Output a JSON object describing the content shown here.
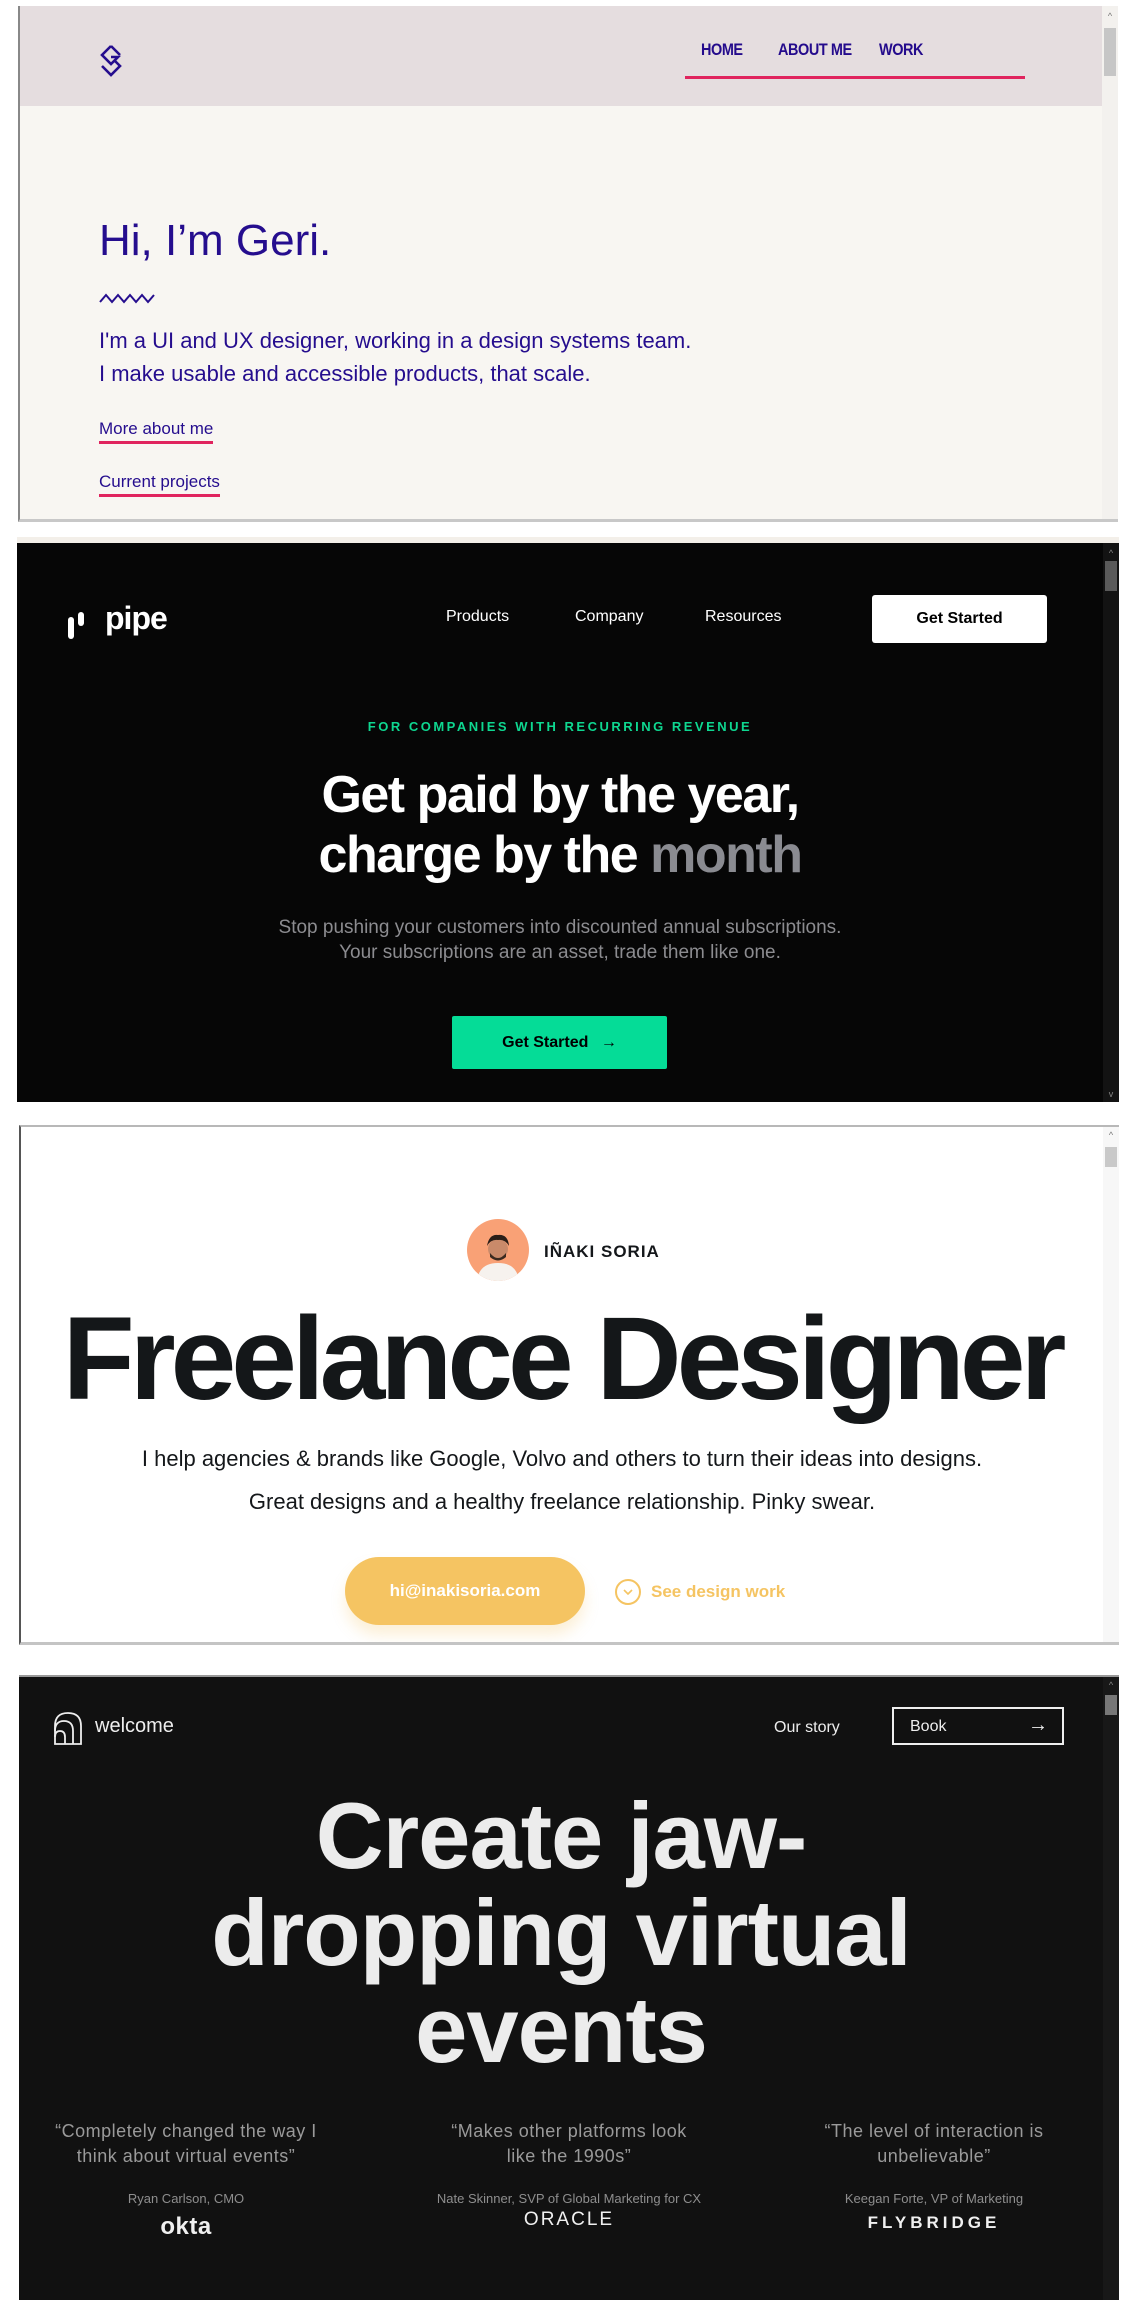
{
  "geri": {
    "nav": [
      "HOME",
      "ABOUT ME",
      "WORK"
    ],
    "title": "Hi, I’m Geri.",
    "lead_lines": [
      "I'm a UI and UX designer, working in a design systems team.",
      "I make usable and accessible products, that scale."
    ],
    "links": [
      "More about me",
      "Current projects"
    ],
    "colors": {
      "primary": "#250d8e",
      "accent": "#e0245e",
      "header_bg": "#e5dddf",
      "page_bg": "#f8f6f2"
    }
  },
  "pipe": {
    "logo_text": "pipe",
    "nav": [
      "Products",
      "Company",
      "Resources"
    ],
    "top_button": "Get Started",
    "eyebrow": "FOR COMPANIES WITH RECURRING REVENUE",
    "headline_line1": "Get paid by the year,",
    "headline_line2_a": "charge by the",
    "headline_line2_b": "month",
    "sub_line1": "Stop pushing your customers into discounted annual subscriptions.",
    "sub_line2": "Your subscriptions are an asset, trade them like one.",
    "cta": "Get Started",
    "cta_arrow": "→",
    "colors": {
      "accent": "#05dc97",
      "bg": "#060606"
    }
  },
  "inaki": {
    "name": "IÑAKI SORIA",
    "headline": "Freelance Designer",
    "sub_line1": "I help agencies & brands like Google, Volvo and others to turn their ideas into designs.",
    "sub_line2": "Great designs and a healthy freelance relationship. Pinky swear.",
    "email_button": "hi@inakisoria.com",
    "secondary_link": "See design work",
    "colors": {
      "accent": "#f5c462",
      "avatar_bg": "#f9a176"
    }
  },
  "welcome": {
    "logo_text": "welcome",
    "nav_link": "Our story",
    "book_button": "Book",
    "book_arrow": "→",
    "headline_line1": "Create jaw-",
    "headline_line2": "dropping virtual",
    "headline_line3": "events",
    "testimonials": [
      {
        "quote": "“Completely changed the way I think about virtual events”",
        "author": "Ryan Carlson, CMO",
        "brand": "okta"
      },
      {
        "quote": "“Makes other platforms look like the 1990s”",
        "author": "Nate Skinner, SVP of Global Marketing for CX",
        "brand": "ORACLE"
      },
      {
        "quote": "“The level of interaction is unbelievable”",
        "author": "Keegan Forte, VP of Marketing",
        "brand": "FLYBRIDGE"
      }
    ]
  },
  "scrollbar": {
    "up_arrow": "^",
    "down_arrow": "v"
  }
}
